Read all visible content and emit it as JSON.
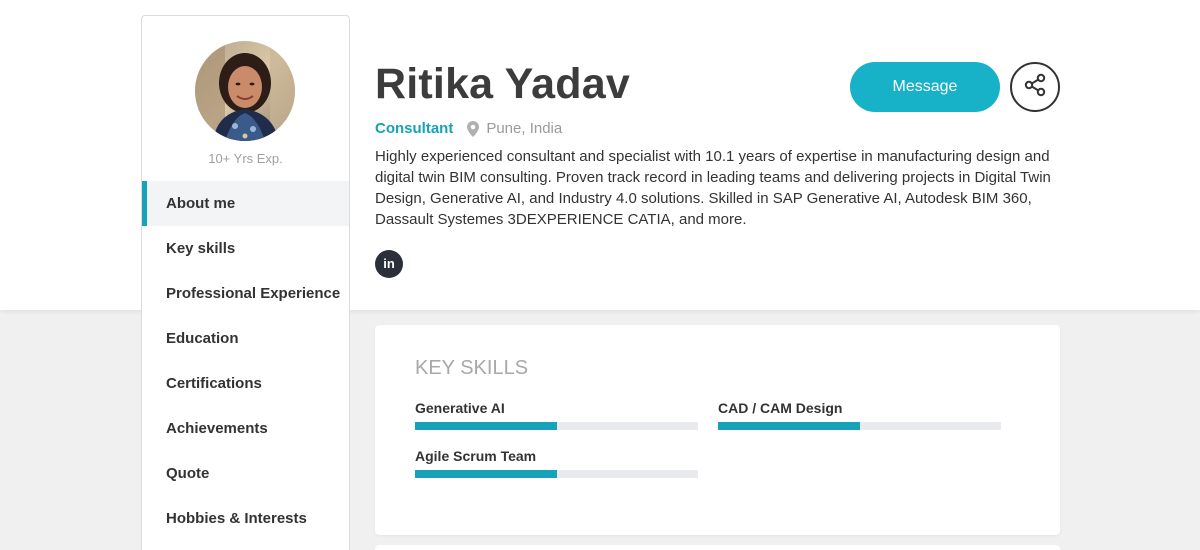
{
  "profile": {
    "name": "Ritika Yadav",
    "role": "Consultant",
    "location": "Pune, India",
    "experience": "10+ Yrs Exp.",
    "bio": "Highly experienced consultant and specialist with 10.1 years of expertise in manufacturing design and digital twin BIM consulting. Proven track record in leading teams and delivering projects in Digital Twin Design, Generative AI, and Industry 4.0 solutions. Skilled in SAP Generative AI, Autodesk BIM 360, Dassault Systemes 3DEXPERIENCE CATIA, and more.",
    "social": {
      "linkedin_label": "in"
    }
  },
  "actions": {
    "message_label": "Message",
    "share_icon": "share-icon"
  },
  "sidebar": {
    "items": [
      {
        "label": "About me",
        "active": true
      },
      {
        "label": "Key skills",
        "active": false
      },
      {
        "label": "Professional Experience",
        "active": false
      },
      {
        "label": "Education",
        "active": false
      },
      {
        "label": "Certifications",
        "active": false
      },
      {
        "label": "Achievements",
        "active": false
      },
      {
        "label": "Quote",
        "active": false
      },
      {
        "label": "Hobbies & Interests",
        "active": false
      }
    ]
  },
  "skills": {
    "title": "KEY SKILLS",
    "items": [
      {
        "label": "Generative AI",
        "level": 0.5
      },
      {
        "label": "CAD / CAM Design",
        "level": 0.5
      },
      {
        "label": "Agile Scrum Team",
        "level": 0.5
      }
    ]
  },
  "colors": {
    "accent": "#17a2b8",
    "button": "#17b1c8",
    "text": "#333333",
    "muted": "#9a9a9a"
  }
}
